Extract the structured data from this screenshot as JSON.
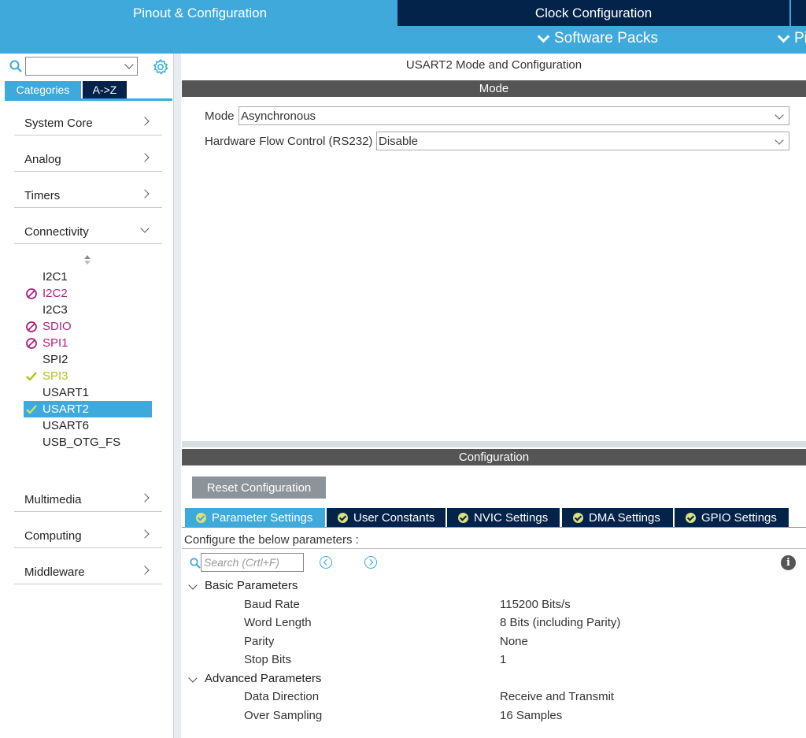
{
  "header": {
    "tab_pinout": "Pinout & Configuration",
    "tab_clock": "Clock Configuration",
    "software_packs": "Software Packs",
    "pinout_menu": "Pinout"
  },
  "left": {
    "search_value": "",
    "tabs": {
      "categories": "Categories",
      "az": "A->Z"
    },
    "categories": [
      {
        "label": "System Core"
      },
      {
        "label": "Analog"
      },
      {
        "label": "Timers"
      },
      {
        "label": "Connectivity"
      },
      {
        "label": "Multimedia"
      },
      {
        "label": "Computing"
      },
      {
        "label": "Middleware"
      }
    ],
    "peripherals": [
      {
        "name": "I2C1",
        "status": "normal"
      },
      {
        "name": "I2C2",
        "status": "blocked"
      },
      {
        "name": "I2C3",
        "status": "normal"
      },
      {
        "name": "SDIO",
        "status": "blocked"
      },
      {
        "name": "SPI1",
        "status": "blocked"
      },
      {
        "name": "SPI2",
        "status": "normal"
      },
      {
        "name": "SPI3",
        "status": "warning"
      },
      {
        "name": "USART1",
        "status": "normal"
      },
      {
        "name": "USART2",
        "status": "enabled"
      },
      {
        "name": "USART6",
        "status": "normal"
      },
      {
        "name": "USB_OTG_FS",
        "status": "normal"
      }
    ]
  },
  "mode": {
    "title": "USART2 Mode and Configuration",
    "section": "Mode",
    "mode_label": "Mode",
    "mode_value": "Asynchronous",
    "flow_label": "Hardware Flow Control (RS232)",
    "flow_value": "Disable"
  },
  "config": {
    "section": "Configuration",
    "reset_label": "Reset Configuration",
    "tabs": [
      {
        "label": "Parameter Settings"
      },
      {
        "label": "User Constants"
      },
      {
        "label": "NVIC Settings"
      },
      {
        "label": "DMA Settings"
      },
      {
        "label": "GPIO Settings"
      }
    ],
    "configure_text": "Configure the below parameters :",
    "search_placeholder": "Search (Crtl+F)",
    "groups": [
      {
        "name": "Basic Parameters",
        "params": [
          {
            "name": "Baud Rate",
            "value": "115200 Bits/s"
          },
          {
            "name": "Word Length",
            "value": "8 Bits (including Parity)"
          },
          {
            "name": "Parity",
            "value": "None"
          },
          {
            "name": "Stop Bits",
            "value": "1"
          }
        ]
      },
      {
        "name": "Advanced Parameters",
        "params": [
          {
            "name": "Data Direction",
            "value": "Receive and Transmit"
          },
          {
            "name": "Over Sampling",
            "value": "16 Samples"
          }
        ]
      }
    ]
  },
  "colors": {
    "accent": "#3fa9dc",
    "navy": "#03234b",
    "blocked": "#b01f7a",
    "warning": "#b3c21a"
  }
}
